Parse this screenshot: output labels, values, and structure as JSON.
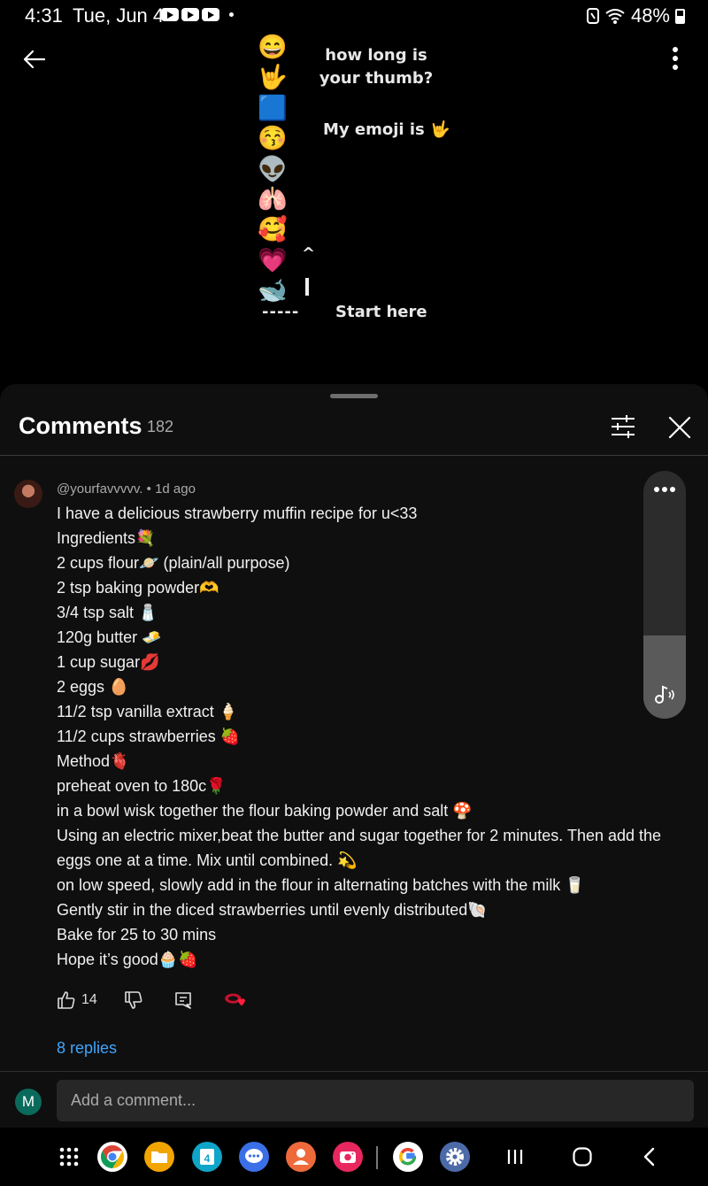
{
  "status_bar": {
    "time": "4:31",
    "date": "Tue, Jun 4",
    "battery": "48%"
  },
  "video": {
    "emojis": [
      "😄",
      "🤟",
      "🟦",
      "😚",
      "👽",
      "🫁",
      "🥰",
      "💗",
      "🐋"
    ],
    "question": "how long is your thumb?",
    "my_emoji": "My emoji is 🤟",
    "arrow": "^",
    "dashes": "-----",
    "start_here": "Start here"
  },
  "comments": {
    "title": "Comments",
    "count": "182",
    "comment": {
      "author": "@yourfavvvvv.",
      "age": "1d ago",
      "lines": [
        "I have a delicious strawberry muffin recipe for u<33",
        "Ingredients💐",
        "2 cups flour🪐 (plain/all purpose)",
        "2 tsp baking powder🫶",
        "3/4 tsp salt 🧂",
        "120g butter 🧈",
        "1 cup sugar💋",
        "2 eggs 🥚",
        "11/2 tsp vanilla extract 🍦",
        "11/2 cups strawberries 🍓",
        "Method🫀",
        "preheat oven to 180c🌹",
        "in a bowl wisk together the flour baking powder and salt 🍄",
        "Using an electric mixer,beat the butter and sugar together for 2 minutes. Then add the eggs one at a time. Mix until combined. 💫",
        "on low speed, slowly add in the flour in alternating batches with the milk 🥛",
        "Gently stir in the diced strawberries until evenly distributed🐚",
        "Bake for 25 to 30 mins",
        "Hope it’s good🧁🍓"
      ],
      "likes": "14",
      "replies": "8 replies"
    }
  },
  "add_comment": {
    "user_initial": "M",
    "placeholder": "Add a comment..."
  },
  "nav_apps": [
    {
      "name": "app-drawer-icon"
    },
    {
      "name": "chrome-icon",
      "color": "#ffffff"
    },
    {
      "name": "files-icon",
      "color": "#f2a400"
    },
    {
      "name": "calendar-icon",
      "color": "#0ea5c8",
      "text": "4"
    },
    {
      "name": "messages-icon",
      "color": "#3a6fe8"
    },
    {
      "name": "contacts-icon",
      "color": "#ef6a3b"
    },
    {
      "name": "camera-icon",
      "color": "#e8275f"
    },
    {
      "name": "google-icon",
      "color": "#ffffff"
    },
    {
      "name": "settings-icon",
      "color": "#4d6aa8"
    }
  ]
}
